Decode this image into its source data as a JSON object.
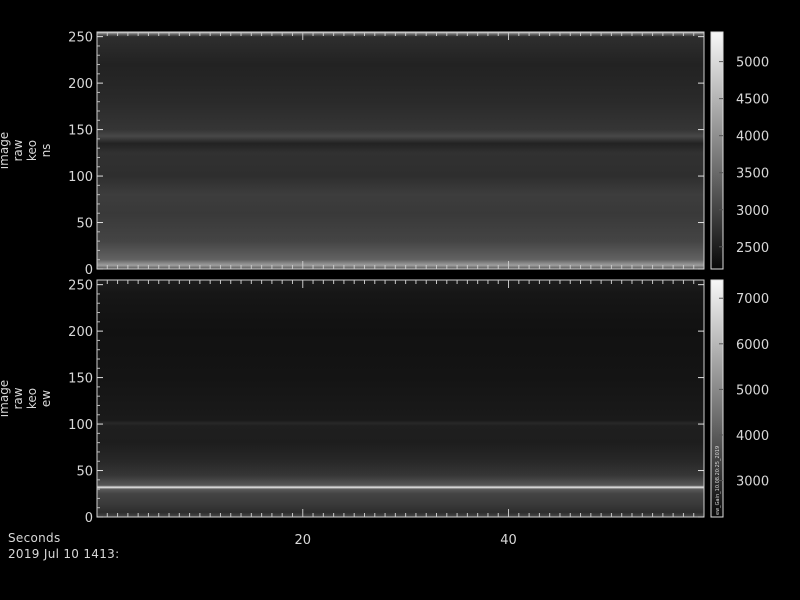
{
  "chart_data": [
    {
      "type": "heatmap",
      "ylabel": [
        "image",
        "raw",
        "keo",
        "ns"
      ],
      "ylim": [
        0,
        255
      ],
      "yticks": [
        0,
        50,
        100,
        150,
        200,
        250
      ],
      "xlim": [
        0,
        59
      ],
      "xticks": [
        20,
        40
      ],
      "colorbar": {
        "ticks": [
          2500,
          3000,
          3500,
          4000,
          4500,
          5000
        ],
        "range": [
          2200,
          5400
        ]
      },
      "profile": [
        {
          "y": 0,
          "v": 3200
        },
        {
          "y": 4,
          "v": 4200
        },
        {
          "y": 10,
          "v": 3400
        },
        {
          "y": 30,
          "v": 3000
        },
        {
          "y": 60,
          "v": 2850
        },
        {
          "y": 80,
          "v": 2900
        },
        {
          "y": 100,
          "v": 2700
        },
        {
          "y": 125,
          "v": 2750
        },
        {
          "y": 135,
          "v": 2550
        },
        {
          "y": 143,
          "v": 3050
        },
        {
          "y": 150,
          "v": 2800
        },
        {
          "y": 180,
          "v": 2650
        },
        {
          "y": 220,
          "v": 2550
        },
        {
          "y": 250,
          "v": 2700
        },
        {
          "y": 253,
          "v": 3600
        },
        {
          "y": 255,
          "v": 5200
        }
      ]
    },
    {
      "type": "heatmap",
      "ylabel": [
        "image",
        "raw",
        "keo",
        "ew"
      ],
      "ylim": [
        0,
        255
      ],
      "yticks": [
        0,
        50,
        100,
        150,
        200,
        250
      ],
      "xlim": [
        0,
        59
      ],
      "xticks": [
        20,
        40
      ],
      "colorbar": {
        "ticks": [
          3000,
          4000,
          5000,
          6000,
          7000
        ],
        "range": [
          2200,
          7400
        ]
      },
      "colorbar_annotation": "ew_Gain_10.08.20:25_2019",
      "profile": [
        {
          "y": 0,
          "v": 3600
        },
        {
          "y": 5,
          "v": 3000
        },
        {
          "y": 15,
          "v": 3300
        },
        {
          "y": 25,
          "v": 3500
        },
        {
          "y": 30,
          "v": 4000
        },
        {
          "y": 32,
          "v": 7000
        },
        {
          "y": 34,
          "v": 3900
        },
        {
          "y": 45,
          "v": 3200
        },
        {
          "y": 60,
          "v": 2900
        },
        {
          "y": 80,
          "v": 2650
        },
        {
          "y": 98,
          "v": 2700
        },
        {
          "y": 101,
          "v": 2900
        },
        {
          "y": 104,
          "v": 2600
        },
        {
          "y": 150,
          "v": 2450
        },
        {
          "y": 200,
          "v": 2400
        },
        {
          "y": 240,
          "v": 2500
        },
        {
          "y": 255,
          "v": 2650
        }
      ]
    }
  ],
  "footer": {
    "xlabel": "Seconds",
    "date": "2019 Jul 10 1413:"
  }
}
